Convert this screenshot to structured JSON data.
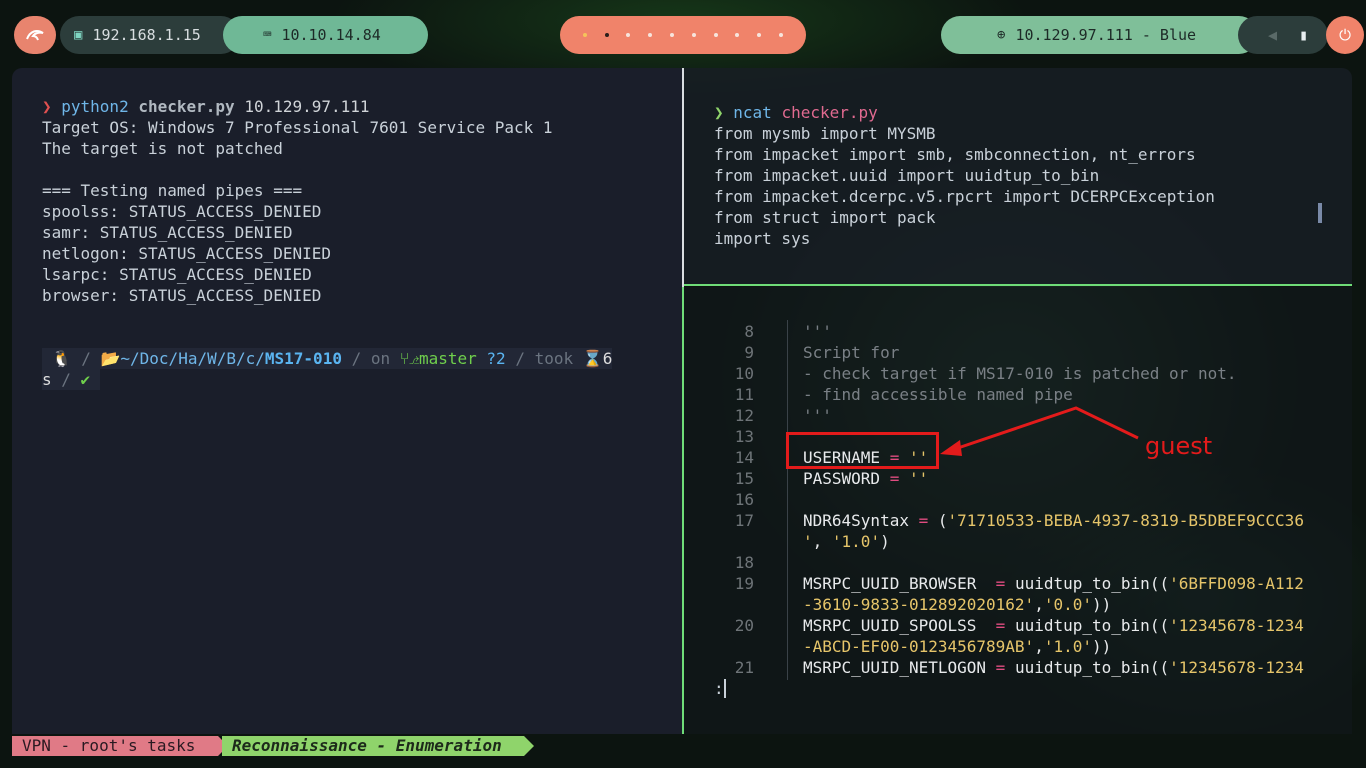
{
  "topbar": {
    "ip_local": "192.168.1.15",
    "ip_vpn": "10.10.14.84",
    "target": "10.129.97.111 - Blue",
    "workspaces": 10
  },
  "left_pane": {
    "line1": {
      "cmd": "python2",
      "script": "checker.py",
      "arg": "10.129.97.111"
    },
    "output": [
      "Target OS: Windows 7 Professional 7601 Service Pack 1",
      "The target is not patched",
      "",
      "=== Testing named pipes ===",
      "spoolss: STATUS_ACCESS_DENIED",
      "samr: STATUS_ACCESS_DENIED",
      "netlogon: STATUS_ACCESS_DENIED",
      "lsarpc: STATUS_ACCESS_DENIED",
      "browser: STATUS_ACCESS_DENIED"
    ],
    "prompt": {
      "path_prefix": "~/Doc/Ha/W/B/c/",
      "path_dir": "MS17-010",
      "on": "on",
      "branch": "master",
      "status": "?2",
      "took": "took",
      "duration_a": "6",
      "duration_b": "s"
    }
  },
  "right_top": {
    "cmd": "ncat",
    "file": "checker.py",
    "lines": [
      "from mysmb import MYSMB",
      "from impacket import smb, smbconnection, nt_errors",
      "from impacket.uuid import uuidtup_to_bin",
      "from impacket.dcerpc.v5.rpcrt import DCERPCException",
      "from struct import pack",
      "import sys"
    ]
  },
  "right_bottom": {
    "line_numbers": [
      "8",
      "9",
      "10",
      "11",
      "12",
      "13",
      "14",
      "15",
      "16",
      "17",
      "",
      "18",
      "19",
      "",
      "20",
      "",
      "21"
    ],
    "code": {
      "l8": "'''",
      "l9": "Script for",
      "l10": "- check target if MS17-010 is patched or not.",
      "l11": "- find accessible named pipe",
      "l12": "'''",
      "l14_var": "USERNAME",
      "l14_val": "''",
      "l15_var": "PASSWORD",
      "l15_val": "''",
      "l17_var": "NDR64Syntax",
      "l17_val1": "'71710533-BEBA-4937-8319-B5DBEF9CCC36",
      "l17_val2": "'",
      "l17_val3": "'1.0'",
      "l19_var": "MSRPC_UUID_BROWSER ",
      "l19_fn": "uuidtup_to_bin((",
      "l19_val1": "'6BFFD098-A112",
      "l19_val2": "-3610-9833-012892020162'",
      "l19_val3": "'0.0'",
      "l20_var": "MSRPC_UUID_SPOOLSS ",
      "l20_val1": "'12345678-1234",
      "l20_val2": "-ABCD-EF00-0123456789AB'",
      "l20_val3": "'1.0'",
      "l21_var": "MSRPC_UUID_NETLOGON",
      "l21_val1": "'12345678-1234"
    },
    "pager_prompt": ":"
  },
  "annotation": {
    "label": "guest",
    "color": "#e31b1b"
  },
  "bottom_bar": {
    "session": "VPN - root's tasks",
    "window": "Reconnaissance - Enumeration"
  }
}
